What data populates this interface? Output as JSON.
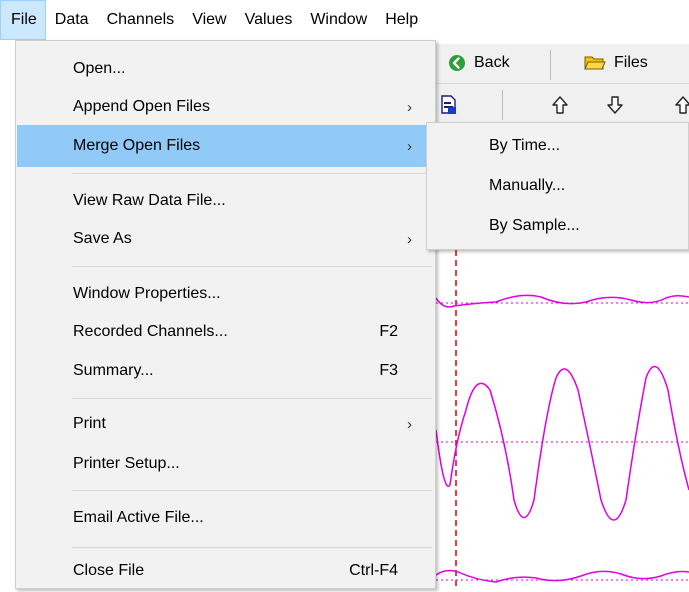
{
  "menubar": {
    "items": [
      "File",
      "Data",
      "Channels",
      "View",
      "Values",
      "Window",
      "Help"
    ],
    "active": "File"
  },
  "toolbar": {
    "back_label": "Back",
    "files_label": "Files"
  },
  "file_menu": {
    "items": [
      {
        "label": "Open...",
        "shortcut": "",
        "submenu": false
      },
      {
        "label": "Append Open Files",
        "shortcut": "",
        "submenu": true
      },
      {
        "label": "Merge Open Files",
        "shortcut": "",
        "submenu": true,
        "highlighted": true
      },
      {
        "label": "View Raw Data File...",
        "shortcut": "",
        "submenu": false
      },
      {
        "label": "Save As",
        "shortcut": "",
        "submenu": true
      },
      {
        "label": "Window Properties...",
        "shortcut": "",
        "submenu": false
      },
      {
        "label": "Recorded Channels...",
        "shortcut": "F2",
        "submenu": false
      },
      {
        "label": "Summary...",
        "shortcut": "F3",
        "submenu": false
      },
      {
        "label": "Print",
        "shortcut": "",
        "submenu": true
      },
      {
        "label": "Printer Setup...",
        "shortcut": "",
        "submenu": false
      },
      {
        "label": "Email Active File...",
        "shortcut": "",
        "submenu": false
      },
      {
        "label": "Close File",
        "shortcut": "Ctrl-F4",
        "submenu": false
      }
    ],
    "submenu_arrow": "›"
  },
  "merge_submenu": {
    "items": [
      "By Time...",
      "Manually...",
      "By Sample..."
    ]
  },
  "colors": {
    "menu_highlight": "#91c9f7",
    "menubar_active": "#cce8ff",
    "trace": "#e000e0",
    "cursor_line": "#e00000",
    "back_icon": "#2e9e3a",
    "folder_icon": "#f2c300"
  },
  "icons": [
    "back-arrow-icon",
    "folder-icon",
    "document-icon",
    "up-arrow-icon",
    "down-arrow-icon"
  ]
}
